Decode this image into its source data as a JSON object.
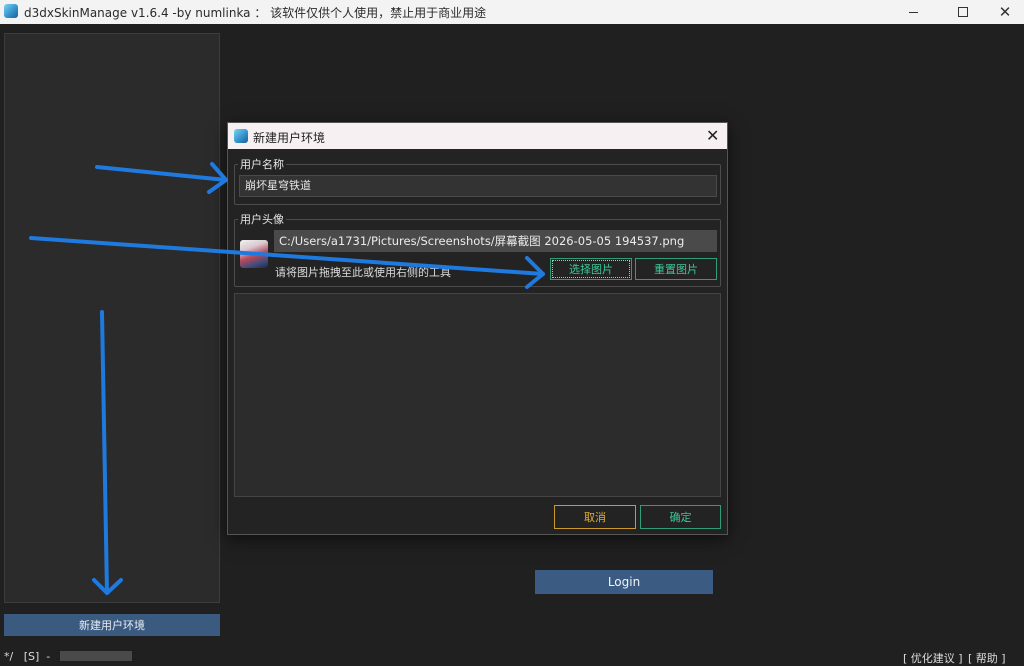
{
  "window": {
    "title": "d3dxSkinManage v1.6.4 -by numlinka ： 该软件仅供个人使用，禁止用于商业用途",
    "minimize_icon": "minimize-icon",
    "maximize_icon": "maximize-icon",
    "close_glyph": "✕"
  },
  "sidebar": {
    "new_env_button": "新建用户环境"
  },
  "login": {
    "label": "Login"
  },
  "statusbar": {
    "left_text": "*/   [S]  -",
    "progress": 0.0,
    "link_optimize": "[ 优化建议 ]",
    "link_help": "[ 帮助 ]"
  },
  "dialog": {
    "title": "新建用户环境",
    "close_glyph": "✕",
    "name_group_label": "用户名称",
    "name_value": "崩坏星穹铁道",
    "avatar_group_label": "用户头像",
    "avatar_path": "C:/Users/a1731/Pictures/Screenshots/屏幕截图 2026-05-05 194537.png",
    "drag_hint": "请将图片拖拽至此或使用右侧的工具",
    "select_image": "选择图片",
    "reset_image": "重置图片",
    "cancel": "取消",
    "confirm": "确定"
  },
  "colors": {
    "annotation_arrow": "#1f7ae0",
    "accent_green": "#3cc79a",
    "accent_orange": "#e4ad32",
    "button_blue": "#3a5a80"
  }
}
